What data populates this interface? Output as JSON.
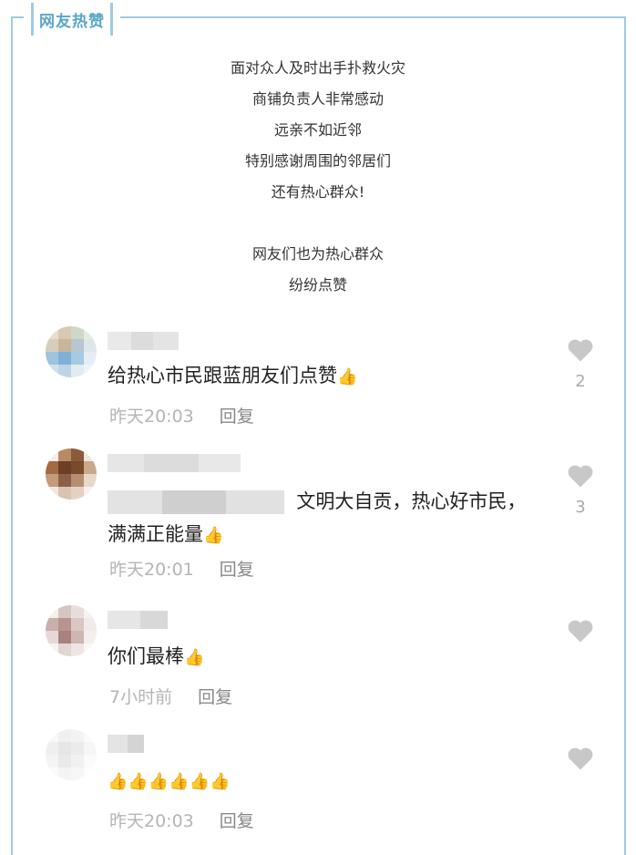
{
  "header": {
    "tab_label": "网友热赞"
  },
  "intro": {
    "lines_a": [
      "面对众人及时出手扑救火灾",
      "商铺负责人非常感动",
      "远亲不如近邻",
      "特别感谢周围的邻居们",
      "还有热心群众!"
    ],
    "lines_b": [
      "网友们也为热心群众",
      "纷纷点赞"
    ]
  },
  "comments": [
    {
      "text": "给热心市民跟蓝朋友们点赞",
      "thumbs": "👍",
      "time": "昨天20:03",
      "reply": "回复",
      "likes": "2"
    },
    {
      "text": "文明大自贡，热心好市民，满满正能量",
      "thumbs": "👍",
      "time": "昨天20:01",
      "reply": "回复",
      "likes": "3"
    },
    {
      "text": "你们最棒",
      "thumbs": "👍",
      "time": "7小时前",
      "reply": "回复",
      "likes": ""
    },
    {
      "text": "",
      "thumbs": "👍👍👍👍👍👍",
      "time": "昨天20:03",
      "reply": "回复",
      "likes": ""
    }
  ],
  "colors": {
    "frame": "#9ecbe0",
    "tab_text": "#5aa6c9",
    "heart": "#c8c8c8"
  },
  "icons": {
    "like": "heart-icon",
    "reaction": "thumbs-up-icon"
  }
}
